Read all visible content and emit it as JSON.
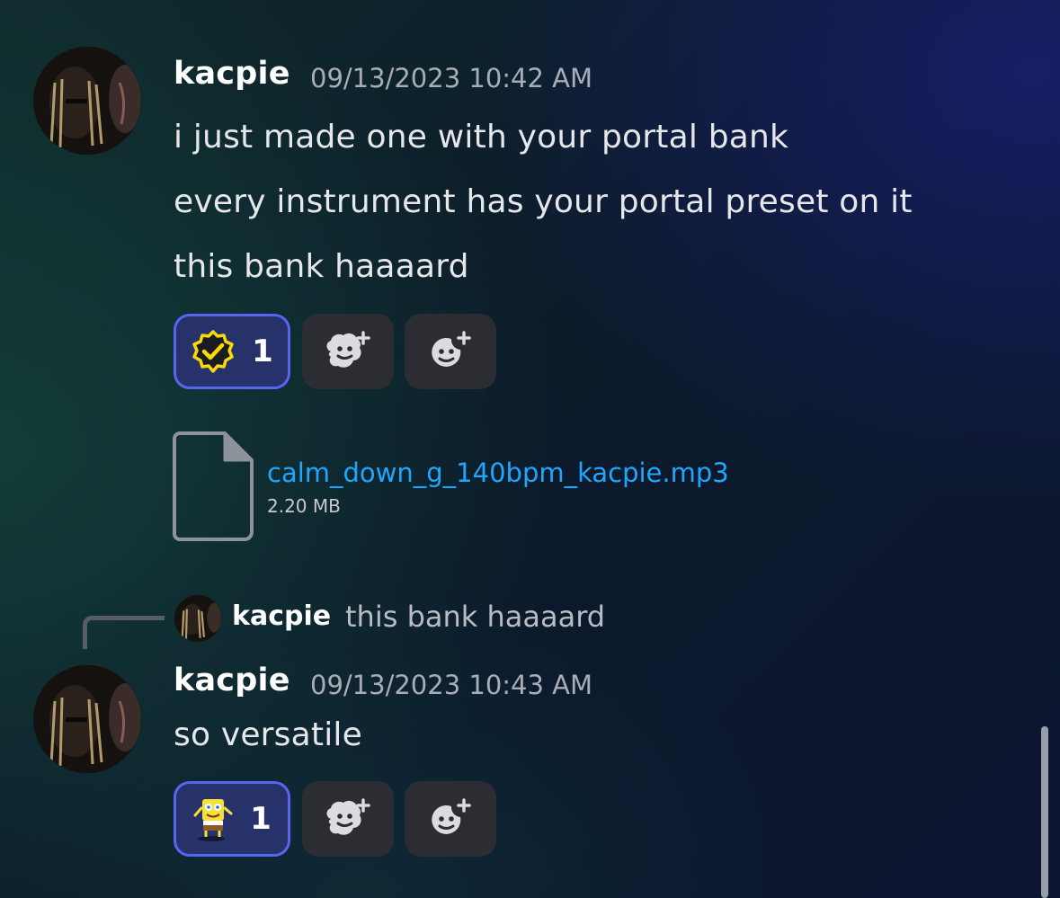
{
  "messages": [
    {
      "username": "kacpie",
      "timestamp": "09/13/2023 10:42 AM",
      "lines": [
        "i just made one with your portal bank",
        "every instrument has your portal preset on it",
        "this bank haaaard"
      ],
      "reactions": [
        {
          "icon": "verified-check-emoji",
          "count": "1",
          "active": true
        },
        {
          "icon": "add-super-reaction-icon"
        },
        {
          "icon": "add-reaction-icon"
        }
      ],
      "attachment": {
        "icon": "file-icon",
        "name": "calm_down_g_140bpm_kacpie.mp3",
        "size": "2.20 MB"
      }
    },
    {
      "reply": {
        "username": "kacpie",
        "text": "this bank haaaard"
      },
      "username": "kacpie",
      "timestamp": "09/13/2023 10:43 AM",
      "lines": [
        "so versatile"
      ],
      "reactions": [
        {
          "icon": "spongebob-emoji",
          "count": "1",
          "active": true
        },
        {
          "icon": "add-super-reaction-icon"
        },
        {
          "icon": "add-reaction-icon"
        }
      ]
    }
  ],
  "colors": {
    "accent": "#5865f2",
    "link": "#1ea7fd",
    "reaction_active_bg": "#27326a",
    "reaction_bg": "#2b2d32",
    "check_yellow": "#f5d90a"
  }
}
